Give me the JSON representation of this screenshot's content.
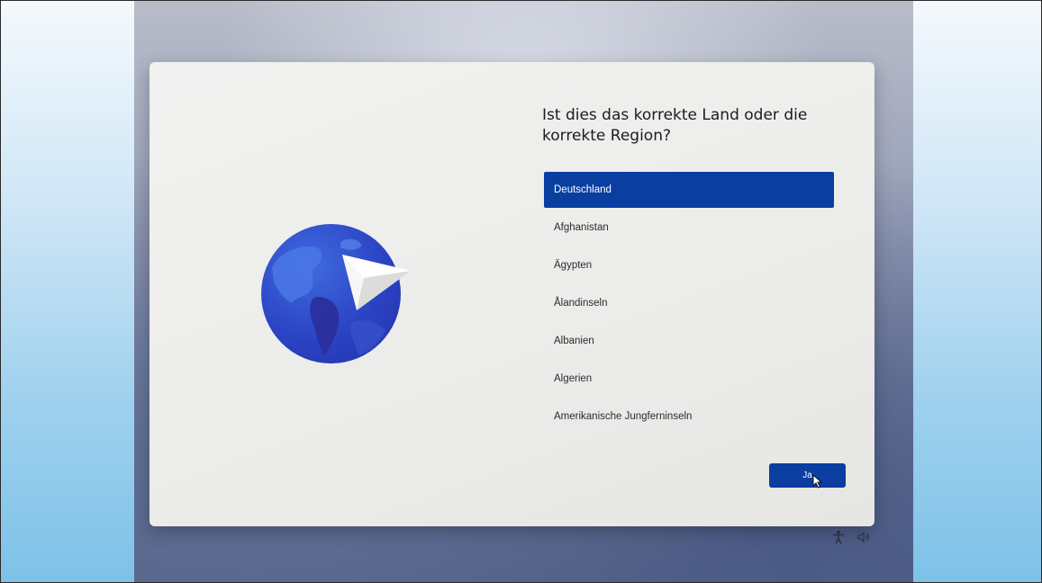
{
  "question": "Ist dies das korrekte Land oder die korrekte Region?",
  "countries": [
    {
      "label": "Deutschland",
      "selected": true
    },
    {
      "label": "Afghanistan",
      "selected": false
    },
    {
      "label": "Ägypten",
      "selected": false
    },
    {
      "label": "Ålandinseln",
      "selected": false
    },
    {
      "label": "Albanien",
      "selected": false
    },
    {
      "label": "Algerien",
      "selected": false
    },
    {
      "label": "Amerikanische Jungferninseln",
      "selected": false
    }
  ],
  "confirm_button": {
    "label": "Ja"
  },
  "icons": {
    "illustration": "globe-paper-plane-icon",
    "accessibility": "accessibility-icon",
    "volume": "volume-icon",
    "cursor": "mouse-cursor-icon"
  },
  "colors": {
    "accent": "#0a3ea0",
    "card_background": "#ececea",
    "globe": "#2b43c4",
    "outer_background": "#9dd0ee"
  }
}
